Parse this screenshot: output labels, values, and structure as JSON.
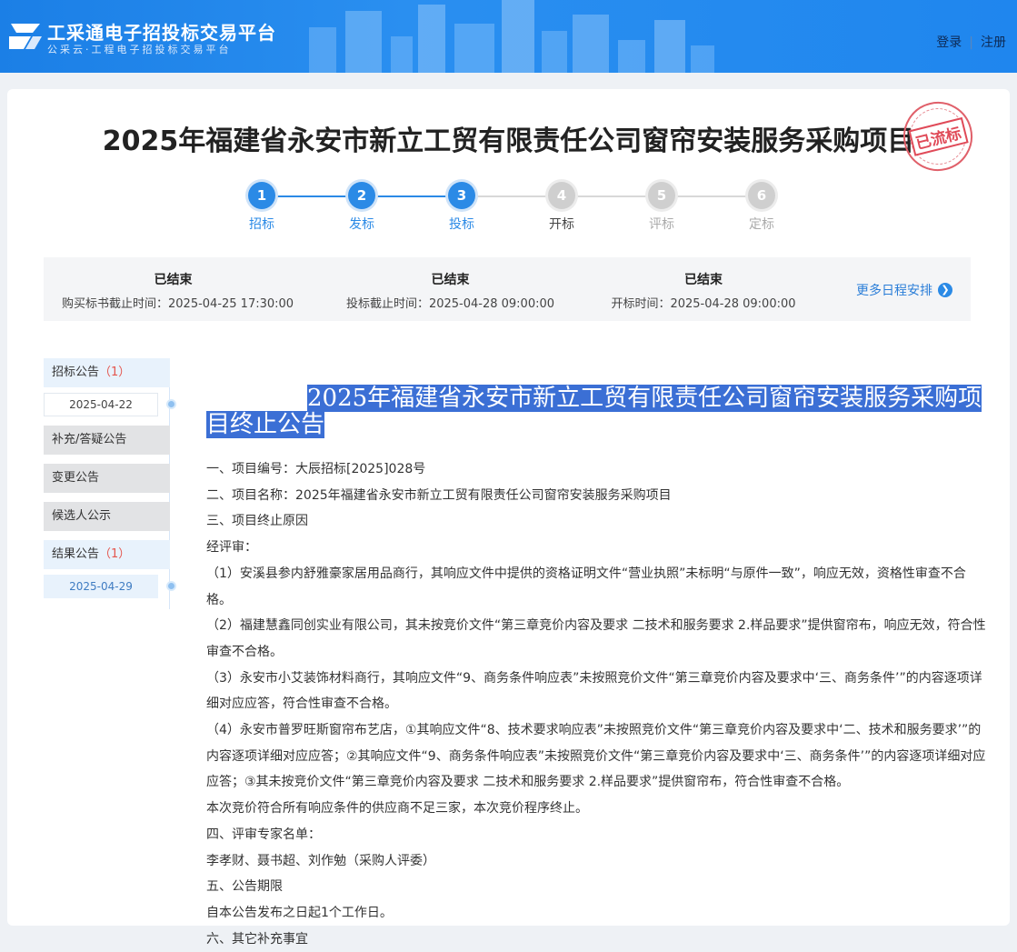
{
  "header": {
    "logo_title": "工采通电子招投标交易平台",
    "logo_subtitle": "公采云·工程电子招投标交易平台",
    "login": "登录",
    "separator": "|",
    "register": "注册"
  },
  "project": {
    "title": "2025年福建省永安市新立工贸有限责任公司窗帘安装服务采购项目",
    "stamp": "已流标"
  },
  "steps": [
    {
      "num": "1",
      "label": "招标",
      "state": "done"
    },
    {
      "num": "2",
      "label": "发标",
      "state": "done"
    },
    {
      "num": "3",
      "label": "投标",
      "state": "done"
    },
    {
      "num": "4",
      "label": "开标",
      "state": "todo-dark"
    },
    {
      "num": "5",
      "label": "评标",
      "state": "todo"
    },
    {
      "num": "6",
      "label": "定标",
      "state": "todo"
    }
  ],
  "schedule": {
    "items": [
      {
        "status": "已结束",
        "time": "购买标书截止时间：2025-04-25 17:30:00"
      },
      {
        "status": "已结束",
        "time": "投标截止时间：2025-04-28 09:00:00"
      },
      {
        "status": "已结束",
        "time": "开标时间：2025-04-28 09:00:00"
      }
    ],
    "more": "更多日程安排"
  },
  "sidebar": {
    "items": [
      {
        "label": "招标公告",
        "count": "（1）",
        "date": "2025-04-22"
      },
      {
        "label": "补充/答疑公告"
      },
      {
        "label": "变更公告"
      },
      {
        "label": "候选人公示"
      },
      {
        "label": "结果公告",
        "count": "（1）",
        "date": "2025-04-29"
      }
    ]
  },
  "notice": {
    "title": "2025年福建省永安市新立工贸有限责任公司窗帘安装服务采购项目终止公告",
    "paragraphs": [
      "一、项目编号：大辰招标[2025]028号",
      "二、项目名称：2025年福建省永安市新立工贸有限责任公司窗帘安装服务采购项目",
      "三、项目终止原因",
      "经评审：",
      "（1）安溪县参内舒雅豪家居用品商行，其响应文件中提供的资格证明文件“营业执照”未标明“与原件一致”，响应无效，资格性审查不合格。",
      "（2）福建慧鑫同创实业有限公司，其未按竞价文件“第三章竞价内容及要求 二技术和服务要求 2.样品要求”提供窗帘布，响应无效，符合性审查不合格。",
      "（3）永安市小艾装饰材料商行，其响应文件“9、商务条件响应表”未按照竞价文件“第三章竞价内容及要求中‘三、商务条件’”的内容逐项详细对应应答，符合性审查不合格。",
      "（4）永安市普罗旺斯窗帘布艺店，①其响应文件“8、技术要求响应表”未按照竞价文件“第三章竞价内容及要求中‘二、技术和服务要求’”的内容逐项详细对应应答；②其响应文件“9、商务条件响应表”未按照竞价文件“第三章竞价内容及要求中‘三、商务条件’”的内容逐项详细对应应答；③其未按竞价文件“第三章竞价内容及要求 二技术和服务要求 2.样品要求”提供窗帘布，符合性审查不合格。",
      "本次竞价符合所有响应条件的供应商不足三家，本次竞价程序终止。",
      "四、评审专家名单：",
      "李孝财、聂书超、刘作勉（采购人评委）",
      "五、公告期限",
      "自本公告发布之日起1个工作日。",
      "六、其它补充事宜"
    ]
  },
  "colors": {
    "header_blue": "#1f86ee",
    "step_active": "#2b8ae6",
    "stamp_red": "#e04a58",
    "selection": "#3b6fd5"
  }
}
